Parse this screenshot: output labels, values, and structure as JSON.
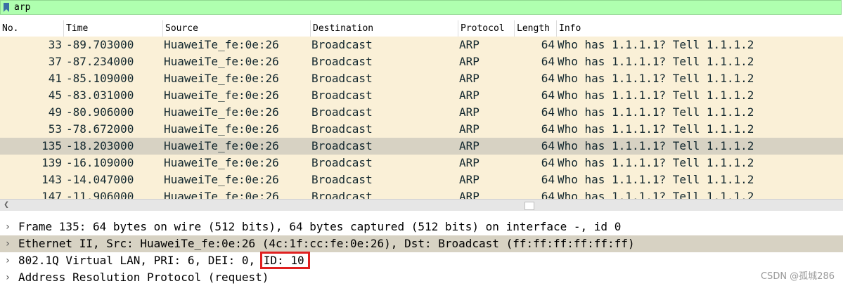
{
  "filter": {
    "value": "arp"
  },
  "columns": {
    "no": "No.",
    "time": "Time",
    "source": "Source",
    "destination": "Destination",
    "protocol": "Protocol",
    "length": "Length",
    "info": "Info"
  },
  "packets": [
    {
      "no": "33",
      "time": "-89.703000",
      "source": "HuaweiTe_fe:0e:26",
      "destination": "Broadcast",
      "protocol": "ARP",
      "length": "64",
      "info": "Who has 1.1.1.1? Tell 1.1.1.2"
    },
    {
      "no": "37",
      "time": "-87.234000",
      "source": "HuaweiTe_fe:0e:26",
      "destination": "Broadcast",
      "protocol": "ARP",
      "length": "64",
      "info": "Who has 1.1.1.1? Tell 1.1.1.2"
    },
    {
      "no": "41",
      "time": "-85.109000",
      "source": "HuaweiTe_fe:0e:26",
      "destination": "Broadcast",
      "protocol": "ARP",
      "length": "64",
      "info": "Who has 1.1.1.1? Tell 1.1.1.2"
    },
    {
      "no": "45",
      "time": "-83.031000",
      "source": "HuaweiTe_fe:0e:26",
      "destination": "Broadcast",
      "protocol": "ARP",
      "length": "64",
      "info": "Who has 1.1.1.1? Tell 1.1.1.2"
    },
    {
      "no": "49",
      "time": "-80.906000",
      "source": "HuaweiTe_fe:0e:26",
      "destination": "Broadcast",
      "protocol": "ARP",
      "length": "64",
      "info": "Who has 1.1.1.1? Tell 1.1.1.2"
    },
    {
      "no": "53",
      "time": "-78.672000",
      "source": "HuaweiTe_fe:0e:26",
      "destination": "Broadcast",
      "protocol": "ARP",
      "length": "64",
      "info": "Who has 1.1.1.1? Tell 1.1.1.2"
    },
    {
      "no": "135",
      "time": "-18.203000",
      "source": "HuaweiTe_fe:0e:26",
      "destination": "Broadcast",
      "protocol": "ARP",
      "length": "64",
      "info": "Who has 1.1.1.1? Tell 1.1.1.2",
      "selected": true
    },
    {
      "no": "139",
      "time": "-16.109000",
      "source": "HuaweiTe_fe:0e:26",
      "destination": "Broadcast",
      "protocol": "ARP",
      "length": "64",
      "info": "Who has 1.1.1.1? Tell 1.1.1.2"
    },
    {
      "no": "143",
      "time": "-14.047000",
      "source": "HuaweiTe_fe:0e:26",
      "destination": "Broadcast",
      "protocol": "ARP",
      "length": "64",
      "info": "Who has 1.1.1.1? Tell 1.1.1.2"
    },
    {
      "no": "147",
      "time": "-11.906000",
      "source": "HuaweiTe_fe:0e:26",
      "destination": "Broadcast",
      "protocol": "ARP",
      "length": "64",
      "info": "Who has 1.1.1.1? Tell 1.1.1.2"
    }
  ],
  "details": [
    {
      "text": "Frame 135: 64 bytes on wire (512 bits), 64 bytes captured (512 bits) on interface -, id 0"
    },
    {
      "text": "Ethernet II, Src: HuaweiTe_fe:0e:26 (4c:1f:cc:fe:0e:26), Dst: Broadcast (ff:ff:ff:ff:ff:ff)",
      "selected": true
    },
    {
      "text": "802.1Q Virtual LAN, PRI: 6, DEI: 0, ",
      "highlight": "ID: 10"
    },
    {
      "text": "Address Resolution Protocol (request)"
    }
  ],
  "icons": {
    "filter_bookmark": "bookmark-icon",
    "expand": "chevron-right-icon",
    "scroll_left": "chevron-left-icon"
  },
  "colors": {
    "filter_bg": "#afffaf",
    "row_bg": "#faf0d7",
    "selected_bg": "#d7d2c3",
    "highlight_border": "#e02020"
  },
  "watermark": "CSDN @孤城286"
}
